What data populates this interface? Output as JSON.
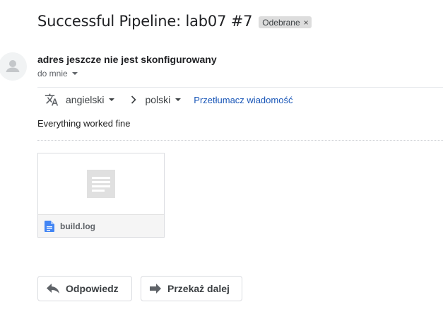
{
  "header": {
    "subject": "Successful Pipeline: lab07 #7",
    "label": "Odebrane",
    "label_remove": "×"
  },
  "message": {
    "sender": "adres jeszcze nie jest skonfigurowany",
    "recipient": "do mnie",
    "body": "Everything worked fine"
  },
  "translate": {
    "source_lang": "angielski",
    "target_lang": "polski",
    "action": "Przetłumacz wiadomość"
  },
  "attachment": {
    "filename": "build.log"
  },
  "actions": {
    "reply": "Odpowiedz",
    "forward": "Przekaż dalej"
  },
  "colors": {
    "link": "#1a57b8",
    "doc_icon": "#4285f4",
    "chip_bg": "#dddddd"
  },
  "icons": [
    "avatar-icon",
    "translate-icon",
    "chevron-right-icon",
    "document-icon",
    "doc-file-icon",
    "reply-icon",
    "forward-icon"
  ]
}
